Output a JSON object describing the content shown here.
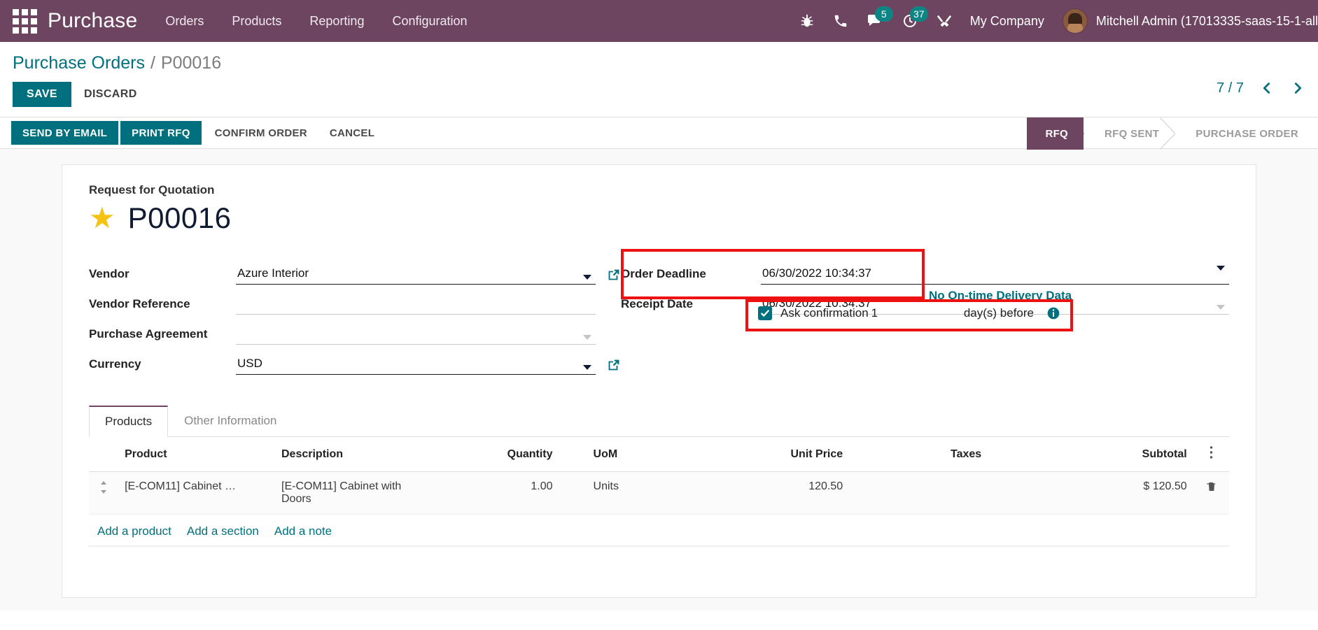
{
  "navbar": {
    "apps_icon": "apps-grid-icon",
    "brand": "Purchase",
    "menu": [
      "Orders",
      "Products",
      "Reporting",
      "Configuration"
    ],
    "icons": [
      {
        "name": "bug-icon",
        "label": "bug"
      },
      {
        "name": "phone-icon",
        "label": "phone"
      },
      {
        "name": "messages-icon",
        "label": "messages",
        "badge": "5"
      },
      {
        "name": "activities-clock-icon",
        "label": "activities",
        "badge": "37"
      },
      {
        "name": "tools-icon",
        "label": "tools"
      }
    ],
    "company": "My Company",
    "user": "Mitchell Admin (17013335-saas-15-1-all"
  },
  "control_panel": {
    "breadcrumb_root": "Purchase Orders",
    "breadcrumb_sep": "/",
    "breadcrumb_current": "P00016",
    "save_label": "SAVE",
    "discard_label": "DISCARD",
    "pager_count": "7 / 7",
    "pager_prev": "previous-record",
    "pager_next": "next-record"
  },
  "statusbar": {
    "buttons": [
      {
        "label": "SEND BY EMAIL",
        "style": "primary"
      },
      {
        "label": "PRINT RFQ",
        "style": "primary"
      },
      {
        "label": "CONFIRM ORDER",
        "style": "text"
      },
      {
        "label": "CANCEL",
        "style": "text"
      }
    ],
    "stages": [
      {
        "label": "RFQ",
        "active": true
      },
      {
        "label": "RFQ SENT",
        "active": false
      },
      {
        "label": "PURCHASE ORDER",
        "active": false
      }
    ]
  },
  "form": {
    "title_label": "Request for Quotation",
    "record_id": "P00016",
    "starred": true,
    "fields_left": [
      {
        "label": "Vendor",
        "value": "Azure Interior",
        "caret": true,
        "external_link": true,
        "solid": true
      },
      {
        "label": "Vendor Reference",
        "value": "",
        "caret": false,
        "external_link": false,
        "solid": false
      },
      {
        "label": "Purchase Agreement",
        "value": "",
        "caret": true,
        "caret_light": true,
        "external_link": false,
        "solid": false
      },
      {
        "label": "Currency",
        "value": "USD",
        "caret": true,
        "external_link": true,
        "solid": true
      }
    ],
    "fields_right": [
      {
        "label": "Order Deadline",
        "value": "06/30/2022 10:34:37"
      },
      {
        "label": "Receipt Date",
        "value": "06/30/2022 10:34:37"
      }
    ],
    "ontime_delivery": "No On-time Delivery Data",
    "ask_confirmation": {
      "label": "Ask confirmation",
      "checked": true,
      "days": "1",
      "unit": "day(s) before",
      "info": "info-icon"
    },
    "highlight_color": "#ee1111"
  },
  "notebook": {
    "tabs": [
      {
        "label": "Products",
        "active": true
      },
      {
        "label": "Other Information",
        "active": false
      }
    ],
    "columns": [
      "Product",
      "Description",
      "Quantity",
      "UoM",
      "Unit Price",
      "Taxes",
      "Subtotal"
    ],
    "rows": [
      {
        "product": "[E-COM11] Cabinet …",
        "description": "[E-COM11] Cabinet with Doors",
        "quantity": "1.00",
        "uom": "Units",
        "unit_price": "120.50",
        "taxes": "",
        "subtotal": "$ 120.50"
      }
    ],
    "add_links": [
      "Add a product",
      "Add a section",
      "Add a note"
    ]
  },
  "colors": {
    "brand_purple": "#6d4560",
    "accent_teal": "#00707f",
    "star_gold": "#f5c211",
    "highlight_red": "#ee1111"
  }
}
